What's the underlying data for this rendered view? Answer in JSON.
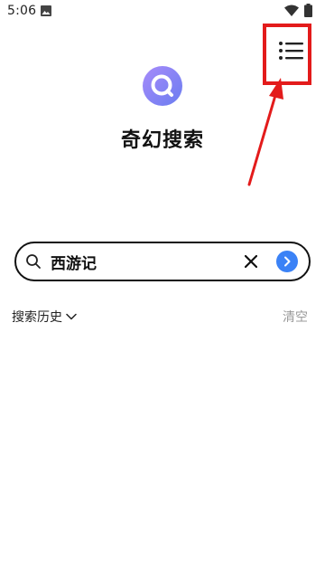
{
  "status_bar": {
    "time": "5:06",
    "icons": [
      "photo-icon",
      "wifi-icon",
      "battery-icon"
    ]
  },
  "header": {
    "menu_icon": "menu-list-icon",
    "annotation_color": "#e31b1b"
  },
  "app": {
    "title": "奇幻搜索",
    "logo_colors": [
      "#9a8cf0",
      "#6a7df0"
    ]
  },
  "search": {
    "value": "西游记",
    "icon": "search-icon",
    "clear_icon": "close-icon",
    "submit_icon": "chevron-right-icon",
    "submit_color": "#3b82f6"
  },
  "history": {
    "label": "搜索历史",
    "toggle_icon": "chevron-down-icon",
    "clear_label": "清空"
  }
}
